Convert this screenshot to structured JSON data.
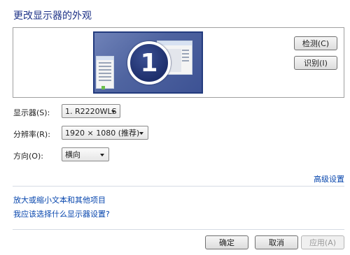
{
  "title": "更改显示器的外观",
  "preview": {
    "monitor_number": "1",
    "detect_button": "检测(C)",
    "identify_button": "识别(I)"
  },
  "settings": {
    "display_label": "显示器(S):",
    "display_value": "1. R2220WLS",
    "resolution_label": "分辨率(R):",
    "resolution_value": "1920 × 1080 (推荐)",
    "orientation_label": "方向(O):",
    "orientation_value": "横向"
  },
  "links": {
    "advanced": "高级设置",
    "text_size": "放大或缩小文本和其他项目",
    "which_settings": "我应该选择什么显示器设置?"
  },
  "footer": {
    "ok": "确定",
    "cancel": "取消",
    "apply": "应用(A)"
  }
}
